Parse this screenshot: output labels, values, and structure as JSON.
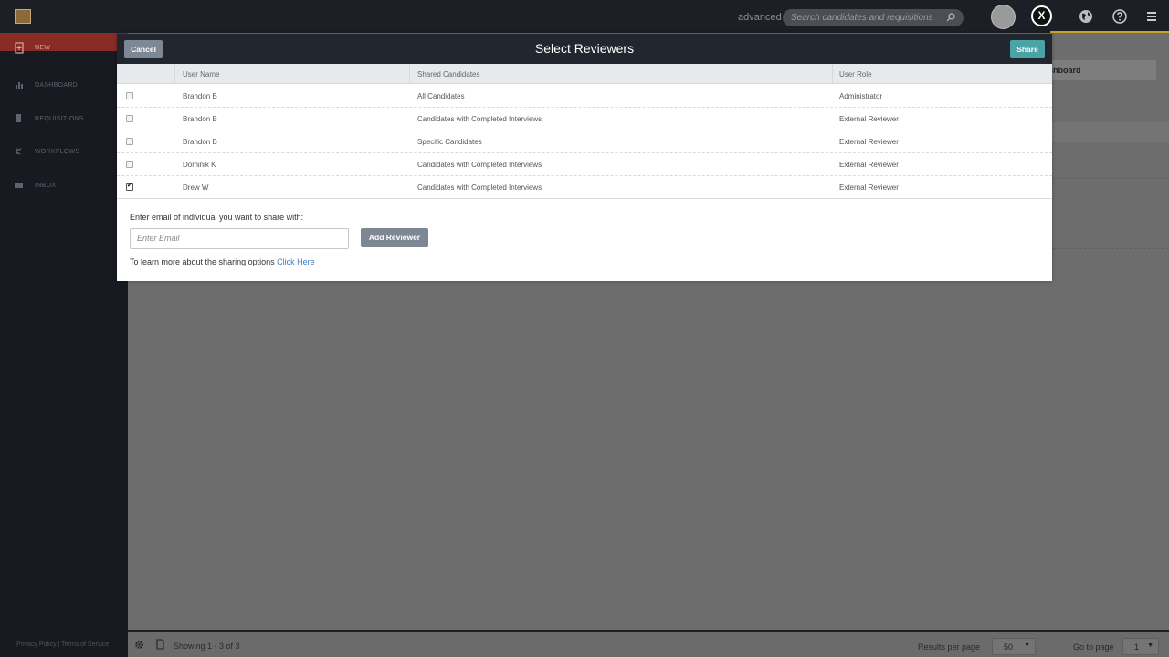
{
  "topbar": {
    "advanced_label": "advanced",
    "search_placeholder": "Search candidates and requisitions",
    "close_label": "X"
  },
  "sidebar": {
    "items": [
      {
        "label": "NEW",
        "icon": "new-doc-icon"
      },
      {
        "label": "DASHBOARD",
        "icon": "bar-chart-icon"
      },
      {
        "label": "REQUISITIONS",
        "icon": "document-icon"
      },
      {
        "label": "WORKFLOWS",
        "icon": "flow-icon"
      },
      {
        "label": "INBOX",
        "icon": "mail-icon"
      }
    ],
    "footer": "Privacy Policy | Terms of Service"
  },
  "background": {
    "tab_label": "ashboard"
  },
  "modal": {
    "title": "Select Reviewers",
    "cancel_label": "Cancel",
    "share_label": "Share",
    "columns": [
      "User Name",
      "Shared Candidates",
      "User Role"
    ],
    "rows": [
      {
        "name": "Brandon B",
        "shared": "All Candidates",
        "role": "Administrator",
        "checked": false
      },
      {
        "name": "Brandon B",
        "shared": "Candidates with Completed Interviews",
        "role": "External Reviewer",
        "checked": false
      },
      {
        "name": "Brandon B",
        "shared": "Specific Candidates",
        "role": "External Reviewer",
        "checked": false
      },
      {
        "name": "Dominik K",
        "shared": "Candidates with Completed Interviews",
        "role": "External Reviewer",
        "checked": false
      },
      {
        "name": "Drew W",
        "shared": "Candidates with Completed Interviews",
        "role": "External Reviewer",
        "checked": true
      }
    ],
    "email_label": "Enter email of individual you want to share with:",
    "email_placeholder": "Enter Email",
    "add_reviewer_label": "Add Reviewer",
    "learn_text": "To learn more about the sharing options",
    "learn_link": "Click Here"
  },
  "bottombar": {
    "showing": "Showing 1 - 3 of 3",
    "results_per_page_label": "Results per page",
    "results_per_page_value": "50",
    "goto_label": "Go to page",
    "goto_value": "1"
  },
  "colors": {
    "accent": "#c9a227",
    "new_item": "#8a2c26",
    "share_button": "#4aa3a4",
    "link": "#3d7ec7"
  }
}
